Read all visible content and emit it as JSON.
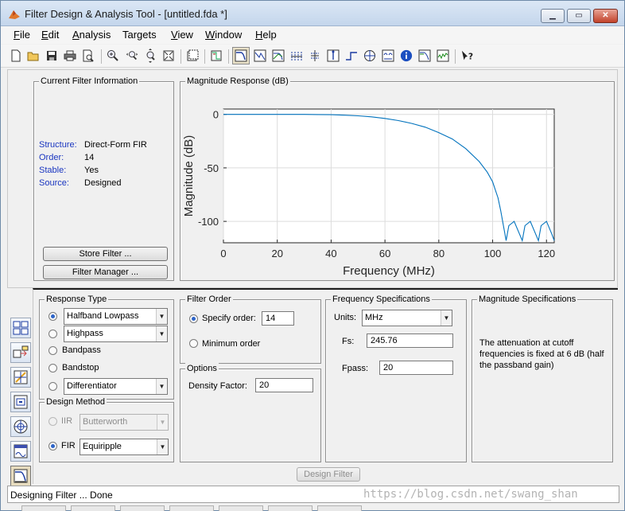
{
  "window": {
    "title": "Filter Design & Analysis Tool -  [untitled.fda *]",
    "controls": {
      "minimize": "▁",
      "maximize": "▭",
      "close": "✕"
    }
  },
  "menu": {
    "items": [
      {
        "label": "File",
        "key": "F",
        "rest": "ile"
      },
      {
        "label": "Edit",
        "key": "E",
        "rest": "dit"
      },
      {
        "label": "Analysis",
        "key": "A",
        "rest": "nalysis"
      },
      {
        "label": "Targets",
        "key": "T",
        "rest": "argets",
        "keyAfter": "a",
        "pre": "T"
      },
      {
        "label": "View",
        "key": "V",
        "rest": "iew"
      },
      {
        "label": "Window",
        "key": "W",
        "rest": "indow"
      },
      {
        "label": "Help",
        "key": "H",
        "rest": "elp"
      }
    ]
  },
  "toolbar": {
    "icons": [
      "new-icon",
      "open-icon",
      "save-icon",
      "print-icon",
      "print-preview-icon",
      "zoom-in-icon",
      "zoom-x-icon",
      "zoom-y-icon",
      "full-view-icon",
      "new-figure-icon",
      "filter-specs-icon",
      "magnitude-response-icon",
      "phase-response-icon",
      "mag-phase-icon",
      "group-delay-icon",
      "phase-delay-icon",
      "impulse-response-icon",
      "step-response-icon",
      "pole-zero-icon",
      "coefficients-icon",
      "filter-info-icon",
      "magnitude-estimate-icon",
      "noise-power-icon",
      "whats-this-icon"
    ]
  },
  "current_filter": {
    "title": "Current Filter Information",
    "fields": [
      {
        "label": "Structure:",
        "value": "Direct-Form FIR"
      },
      {
        "label": "Order:",
        "value": "14"
      },
      {
        "label": "Stable:",
        "value": "Yes"
      },
      {
        "label": "Source:",
        "value": "Designed"
      }
    ],
    "store_button": "Store Filter ...",
    "manager_button": "Filter Manager ..."
  },
  "magnitude_panel": {
    "title": "Magnitude Response (dB)"
  },
  "chart_data": {
    "type": "line",
    "title": "",
    "xlabel": "Frequency (MHz)",
    "ylabel": "Magnitude (dB)",
    "xlim": [
      0,
      122.88
    ],
    "ylim": [
      -120,
      5
    ],
    "xticks": [
      0,
      20,
      40,
      60,
      80,
      100,
      120
    ],
    "yticks": [
      0,
      -50,
      -100
    ],
    "grid": true,
    "color": "#0072bd",
    "x": [
      0,
      10,
      20,
      30,
      35,
      40,
      45,
      50,
      55,
      60,
      65,
      70,
      75,
      80,
      85,
      90,
      95,
      98,
      100,
      102,
      103,
      104,
      105,
      106,
      108,
      110,
      111,
      112,
      114,
      116,
      117,
      118,
      120,
      122,
      122.88
    ],
    "y": [
      0,
      0,
      0,
      0,
      -0.1,
      -0.3,
      -0.7,
      -1.3,
      -2.3,
      -3.8,
      -5.8,
      -8.5,
      -12,
      -17,
      -23,
      -32,
      -44,
      -54,
      -63,
      -78,
      -90,
      -104,
      -118,
      -104,
      -100,
      -112,
      -118,
      -104,
      -100,
      -112,
      -118,
      -104,
      -100,
      -112,
      -118
    ]
  },
  "response_type": {
    "title": "Response Type",
    "options": [
      {
        "label": "Halfband Lowpass",
        "checked": true,
        "dropdown": true
      },
      {
        "label": "Highpass",
        "checked": false,
        "dropdown": true
      },
      {
        "label": "Bandpass",
        "checked": false,
        "dropdown": false
      },
      {
        "label": "Bandstop",
        "checked": false,
        "dropdown": false
      },
      {
        "label": "Differentiator",
        "checked": false,
        "dropdown": true
      }
    ]
  },
  "design_method": {
    "title": "Design Method",
    "iir": {
      "label": "IIR",
      "value": "Butterworth",
      "checked": false,
      "enabled": false
    },
    "fir": {
      "label": "FIR",
      "value": "Equiripple",
      "checked": true,
      "enabled": true
    }
  },
  "filter_order": {
    "title": "Filter Order",
    "specify_label": "Specify order:",
    "specify_value": "14",
    "minimum_label": "Minimum order"
  },
  "options": {
    "title": "Options",
    "density_label": "Density Factor:",
    "density_value": "20"
  },
  "frequency_specs": {
    "title": "Frequency Specifications",
    "units_label": "Units:",
    "units_value": "MHz",
    "fs_label": "Fs:",
    "fs_value": "245.76",
    "fpass_label": "Fpass:",
    "fpass_value": "20"
  },
  "magnitude_specs": {
    "title": "Magnitude Specifications",
    "note": "The attenuation at cutoff frequencies is fixed at 6 dB (half the passband gain)"
  },
  "design_button": "Design Filter",
  "status": {
    "text": "Designing Filter ... Done"
  },
  "watermark": "https://blog.csdn.net/swang_shan"
}
